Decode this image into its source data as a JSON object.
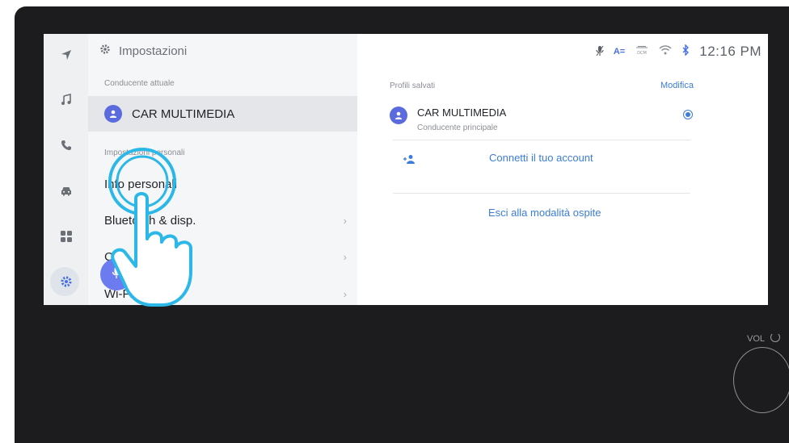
{
  "colors": {
    "accent": "#3b7dd8",
    "avatar": "#5b6bde",
    "touch": "#2bb7e8"
  },
  "rail": {
    "icons": [
      "navigation-icon",
      "music-icon",
      "phone-icon",
      "car-icon",
      "apps-icon",
      "settings-icon"
    ]
  },
  "menu": {
    "title": "Impostazioni",
    "current_driver_label": "Conducente attuale",
    "current_driver": "CAR MULTIMEDIA",
    "section_label": "Impostazioni personali",
    "items": [
      {
        "label": "Info personali"
      },
      {
        "label": "Bluetooth & disp."
      },
      {
        "label": "C"
      },
      {
        "label": "Wi-Fi"
      }
    ]
  },
  "status": {
    "time": "12:16 PM",
    "icons": [
      "mic-off-icon",
      "text-size-icon",
      "dcm-icon",
      "wifi-icon",
      "bluetooth-icon"
    ]
  },
  "content": {
    "saved_profiles_label": "Profili salvati",
    "edit_label": "Modifica",
    "profile": {
      "name": "CAR MULTIMEDIA",
      "subtitle": "Conducente principale"
    },
    "connect_account": "Connetti il tuo account",
    "guest_mode": "Esci alla modalità ospite"
  },
  "hardware": {
    "vol_label": "VOL"
  }
}
